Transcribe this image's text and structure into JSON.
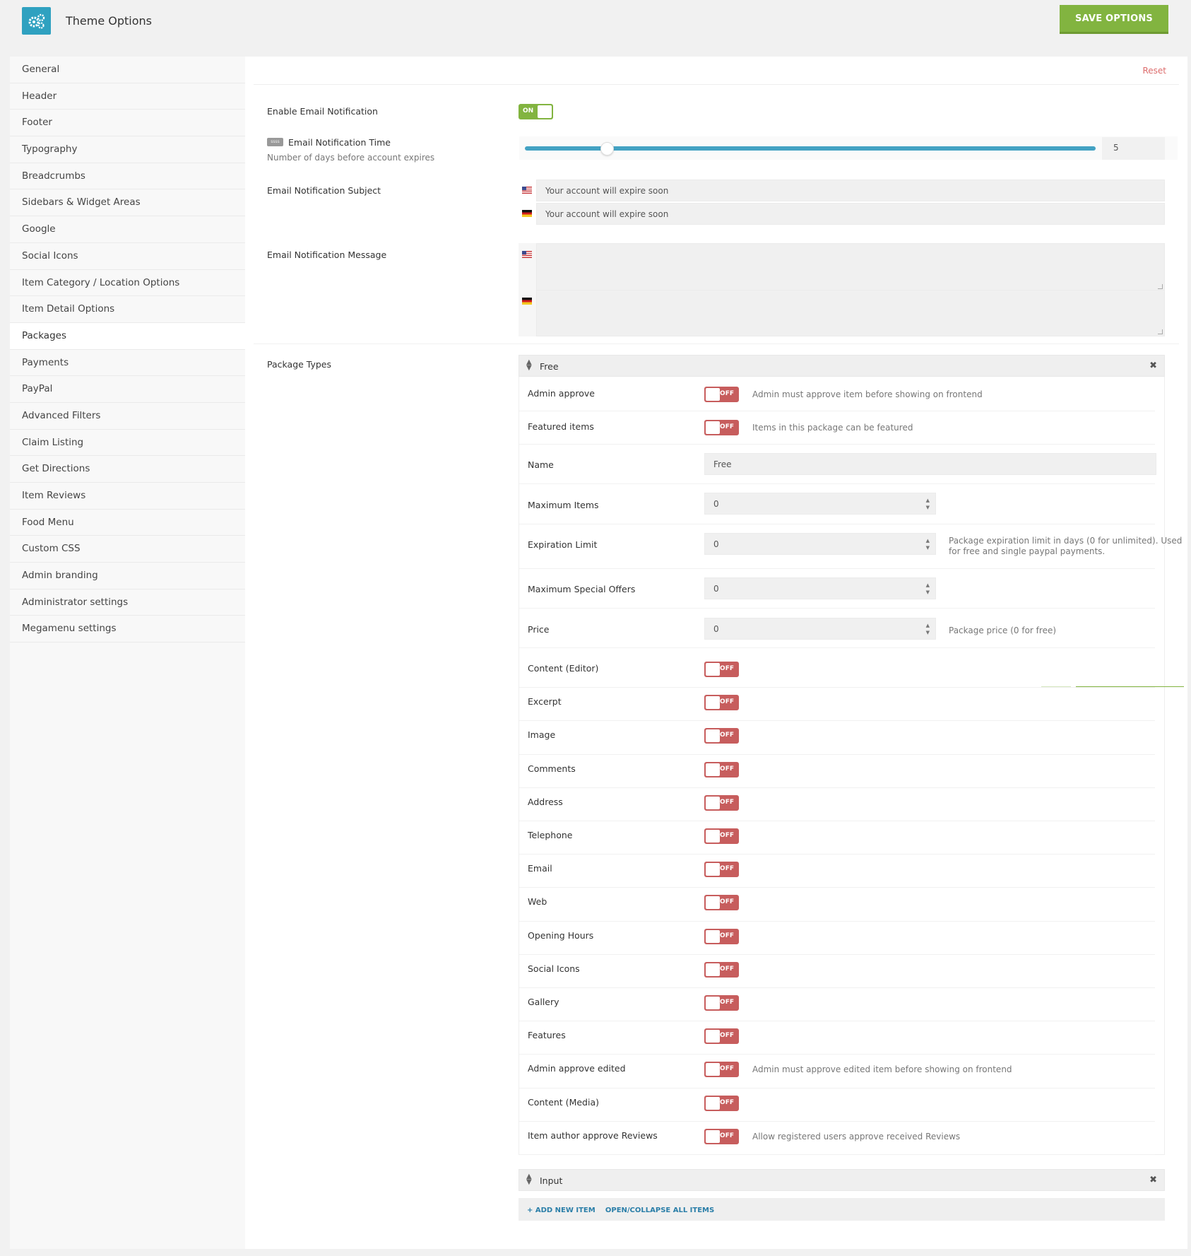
{
  "app": {
    "title": "Theme Options",
    "save_label": "SAVE OPTIONS",
    "colors": {
      "accent": "#82b440",
      "toggle_off": "#c75d5d",
      "slider": "#43a2c3",
      "logo": "#2fa1c0"
    }
  },
  "sidebar": {
    "items": [
      {
        "label": "General"
      },
      {
        "label": "Header"
      },
      {
        "label": "Footer"
      },
      {
        "label": "Typography"
      },
      {
        "label": "Breadcrumbs"
      },
      {
        "label": "Sidebars & Widget Areas"
      },
      {
        "label": "Google"
      },
      {
        "label": "Social Icons"
      },
      {
        "label": "Item Category / Location Options"
      },
      {
        "label": "Item Detail Options"
      },
      {
        "label": "Packages",
        "active": true
      },
      {
        "label": "Payments"
      },
      {
        "label": "PayPal"
      },
      {
        "label": "Advanced Filters"
      },
      {
        "label": "Claim Listing"
      },
      {
        "label": "Get Directions"
      },
      {
        "label": "Item Reviews"
      },
      {
        "label": "Food Menu"
      },
      {
        "label": "Custom CSS"
      },
      {
        "label": "Admin branding"
      },
      {
        "label": "Administrator settings"
      },
      {
        "label": "Megamenu settings"
      }
    ]
  },
  "main": {
    "reset_label": "Reset",
    "email_notification": {
      "label": "Enable Email Notification",
      "toggle": "ON"
    },
    "notification_time": {
      "badge": "ssss",
      "label": "Email Notification Time",
      "desc": "Number of days before account expires",
      "value": "5"
    },
    "subject": {
      "label": "Email Notification Subject",
      "value_en": "Your account will expire soon",
      "value_de": "Your account will expire soon"
    },
    "message": {
      "label": "Email Notification Message"
    },
    "package_types": {
      "label": "Package Types",
      "free": {
        "title": "Free",
        "admin_approve": {
          "label": "Admin approve",
          "toggle": "OFF",
          "desc": "Admin must approve item before showing on frontend"
        },
        "featured": {
          "label": "Featured items",
          "toggle": "OFF",
          "desc": "Items in this package can be featured"
        },
        "name": {
          "label": "Name",
          "value": "Free"
        },
        "max_items": {
          "label": "Maximum Items",
          "value": "0"
        },
        "expiration": {
          "label": "Expiration Limit",
          "value": "0",
          "desc1": "Package expiration limit in days (0 for unlimited). Used",
          "desc2": "for free and single paypal payments."
        },
        "max_offers": {
          "label": "Maximum Special Offers",
          "value": "0"
        },
        "price": {
          "label": "Price",
          "value": "0",
          "desc": "Package price (0 for free)"
        },
        "toggles": [
          {
            "label": "Content (Editor)",
            "toggle": "OFF"
          },
          {
            "label": "Excerpt",
            "toggle": "OFF"
          },
          {
            "label": "Image",
            "toggle": "OFF"
          },
          {
            "label": "Comments",
            "toggle": "OFF"
          },
          {
            "label": "Address",
            "toggle": "OFF"
          },
          {
            "label": "Telephone",
            "toggle": "OFF"
          },
          {
            "label": "Email",
            "toggle": "OFF"
          },
          {
            "label": "Web",
            "toggle": "OFF"
          },
          {
            "label": "Opening Hours",
            "toggle": "OFF"
          },
          {
            "label": "Social Icons",
            "toggle": "OFF"
          },
          {
            "label": "Gallery",
            "toggle": "OFF"
          },
          {
            "label": "Features",
            "toggle": "OFF"
          },
          {
            "label": "Admin approve edited",
            "toggle": "OFF",
            "desc": "Admin must approve edited item before showing on frontend"
          },
          {
            "label": "Content (Media)",
            "toggle": "OFF"
          },
          {
            "label": "Item author approve Reviews",
            "toggle": "OFF",
            "desc": "Allow registered users approve received Reviews"
          }
        ]
      },
      "input": {
        "title": "Input"
      },
      "add_new": "+ ADD NEW ITEM",
      "open_collapse": "OPEN/COLLAPSE ALL ITEMS"
    }
  }
}
